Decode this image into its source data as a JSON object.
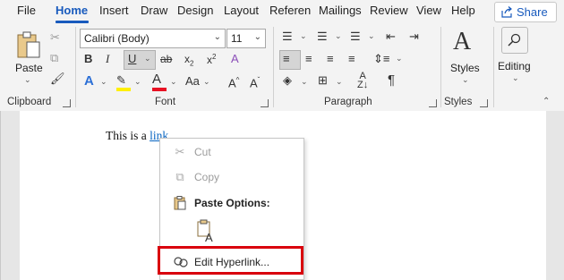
{
  "tabs": [
    "File",
    "Home",
    "Insert",
    "Draw",
    "Design",
    "Layout",
    "Referen",
    "Mailings",
    "Review",
    "View",
    "Help"
  ],
  "share_label": "Share",
  "ribbon": {
    "clipboard": {
      "label": "Clipboard",
      "paste_label": "Paste"
    },
    "font": {
      "label": "Font",
      "font_name": "Calibri (Body)",
      "font_size": "11"
    },
    "paragraph": {
      "label": "Paragraph"
    },
    "styles": {
      "label": "Styles",
      "button_label": "Styles"
    },
    "editing": {
      "label": "Editing"
    }
  },
  "document": {
    "text_before": "This is a ",
    "link_text": "link",
    "text_after": "."
  },
  "context_menu": {
    "cut": "Cut",
    "copy": "Copy",
    "paste_options": "Paste Options:",
    "edit_hyperlink": "Edit Hyperlink..."
  },
  "colors": {
    "accent": "#185abd",
    "link": "#0563c1",
    "highlight_box": "#d9000d"
  },
  "icons": [
    "share-icon",
    "paste-icon",
    "cut-icon",
    "copy-icon",
    "format-painter-icon",
    "bold-icon",
    "italic-icon",
    "underline-icon",
    "strikethrough-icon",
    "subscript-icon",
    "superscript-icon",
    "clear-formatting-icon",
    "text-effects-icon",
    "highlight-icon",
    "font-color-icon",
    "change-case-icon",
    "grow-font-icon",
    "shrink-font-icon",
    "bullets-icon",
    "numbering-icon",
    "multilevel-list-icon",
    "decrease-indent-icon",
    "increase-indent-icon",
    "align-left-icon",
    "center-icon",
    "align-right-icon",
    "justify-icon",
    "line-spacing-icon",
    "shading-icon",
    "borders-icon",
    "sort-icon",
    "show-marks-icon",
    "styles-icon",
    "search-icon",
    "keep-text-only-icon",
    "hyperlink-icon"
  ]
}
